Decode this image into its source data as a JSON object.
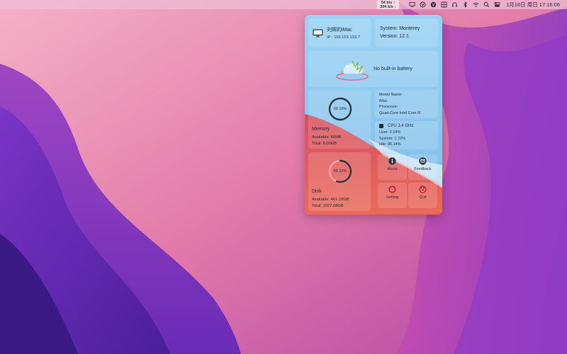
{
  "menubar": {
    "net_up": "54 b/s ↑",
    "net_down": "304 b/s ↓",
    "clock": "1月16日 周日  17:16:06",
    "icons": [
      "display-icon",
      "vpn-icon",
      "vpn-badge-icon",
      "grid-icon",
      "headphones-icon",
      "bluetooth-icon",
      "wifi-icon",
      "search-icon",
      "control-center-icon",
      "siri-icon"
    ]
  },
  "popup": {
    "host": {
      "name": "刘辉的iMac",
      "ip": "IP : 119.123.133.7"
    },
    "system": {
      "os": "System: Monterey",
      "version": "Version: 12.1"
    },
    "battery": {
      "text": "No built-in battery"
    },
    "memory": {
      "percent_label": "99.16%",
      "percent": 99.16,
      "title": "Memory",
      "available": "Available: 66MB",
      "total": "Total: 8.00GB"
    },
    "model": {
      "name_label": "Model Name:",
      "name": "iMac",
      "processor_label": "Processor:",
      "processor": "Quad-Core Intel Core i5"
    },
    "cpu": {
      "title": "CPU  3.4 GHz",
      "user": "User:   2.14%",
      "system": "System:   1.72%",
      "idle": "Idle:   96.14%"
    },
    "disk": {
      "percent_label": "55.12%",
      "percent": 55.12,
      "title": "Disk",
      "available": "Available: 461.18GB",
      "total": "Total: 1027.68GB"
    },
    "buttons": {
      "about": "About",
      "feedback": "Feedback",
      "setting": "Setting",
      "quit": "Quit"
    }
  },
  "colors": {
    "accent_ring": "#2c3542",
    "quit_red": "#d2232a",
    "popup_blue": "#8ec9ef",
    "popup_red": "#e8545a"
  }
}
